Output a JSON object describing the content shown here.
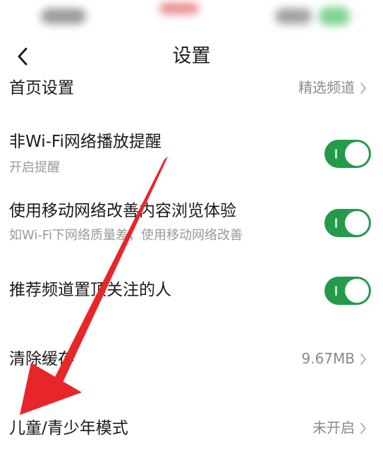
{
  "header": {
    "title": "设置",
    "back_icon": "chevron-left-icon"
  },
  "settings": {
    "home": {
      "label": "首页设置",
      "value": "精选频道"
    },
    "non_wifi": {
      "label": "非Wi-Fi网络播放提醒",
      "sublabel": "开启提醒",
      "enabled": true
    },
    "mobile_data": {
      "label": "使用移动网络改善内容浏览体验",
      "sublabel": "如Wi-Fi下网络质量差，使用移动网络改善",
      "enabled": true
    },
    "pin_follow": {
      "label": "推荐频道置顶关注的人",
      "enabled": true
    },
    "clear_cache": {
      "label": "清除缓存",
      "value": "9.67MB"
    },
    "kids_mode": {
      "label": "儿童/青少年模式",
      "value": "未开启"
    }
  },
  "colors": {
    "toggle_on": "#249a4a",
    "annotation_arrow": "#e8262a",
    "secondary_text": "#9a9a9a"
  }
}
